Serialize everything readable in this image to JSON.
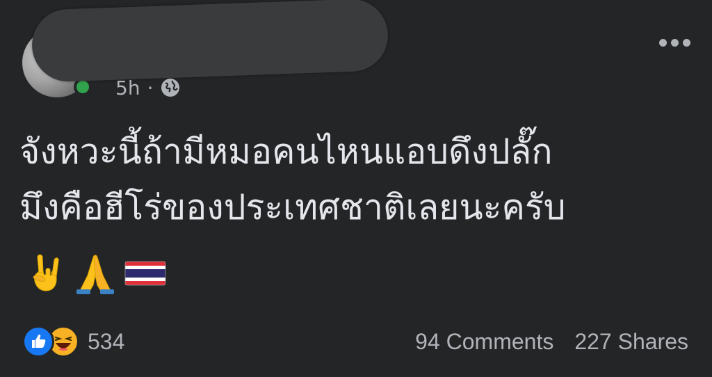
{
  "post": {
    "timestamp": "5h",
    "separator": "·",
    "audience_icon": "globe-icon",
    "more_icon": "more-options-icon",
    "text_lines": [
      "จังหวะนี้ถ้ามีหมอคนไหนแอบดึงปลั๊ก",
      "มึงคือฮีโร่ของประเทศชาติเลยนะครับ"
    ],
    "emojis": [
      "sign-of-the-horns-emoji",
      "folded-hands-emoji",
      "thailand-flag-emoji"
    ]
  },
  "stats": {
    "reaction_icons": [
      "like-icon",
      "haha-icon"
    ],
    "reaction_count": "534",
    "comments": "94 Comments",
    "shares": "227 Shares"
  },
  "colors": {
    "background": "#242526",
    "text_primary": "#e4e6eb",
    "text_secondary": "#b0b3b8",
    "like_blue": "#1877f2",
    "haha_yellow": "#f7b125",
    "online_green": "#31a24c"
  }
}
